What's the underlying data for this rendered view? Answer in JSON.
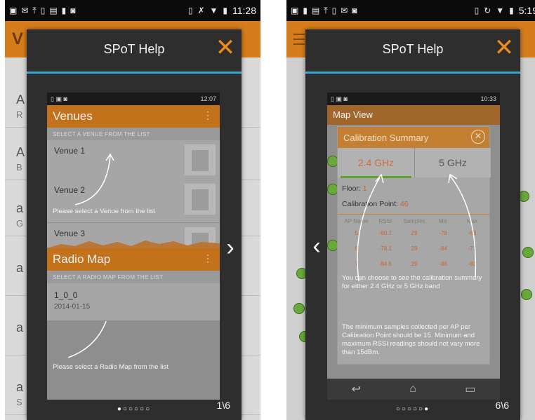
{
  "panel_left": {
    "status": {
      "time": "11:28"
    },
    "background_rows": [
      {
        "title": "A",
        "sub": "R"
      },
      {
        "title": "A",
        "sub": "B"
      },
      {
        "title": "a",
        "sub": "G"
      },
      {
        "title": "a",
        "sub": ""
      },
      {
        "title": "a",
        "sub": ""
      },
      {
        "title": "a",
        "sub": "S"
      }
    ],
    "app_initial": "V",
    "dialog": {
      "title": "SPoT Help",
      "close": "✕",
      "next_arrow": "›",
      "pager": "●○○○○○",
      "page_count": "1\\6"
    },
    "screenshot": {
      "status_time": "12:07",
      "venues_header": "Venues",
      "venues_sub": "SELECT A VENUE FROM THE LIST",
      "venues": [
        "Venue 1",
        "Venue 2",
        "Venue 3"
      ],
      "venue_hint": "Please select a Venue from the list",
      "radiomap_header": "Radio Map",
      "radiomap_sub": "SELECT A RADIO MAP FROM THE LIST",
      "radiomap_item": "1_0_0",
      "radiomap_date": "2014-01-15",
      "radiomap_hint": "Please select a Radio Map from the list"
    }
  },
  "panel_right": {
    "status": {
      "time": "5:19"
    },
    "dialog": {
      "title": "SPoT Help",
      "close": "✕",
      "prev_arrow": "‹",
      "pager": "○○○○○●",
      "page_count": "6\\6"
    },
    "screenshot": {
      "status_time": "10:33",
      "map_title": "Map View",
      "cal_title": "Calibration Summary",
      "cal_close": "✕",
      "band_24": "2.4 GHz",
      "band_5": "5 GHz",
      "floor_label": "Floor:",
      "floor_value": "1",
      "cal_point_label": "Calibration Point:",
      "cal_point_value": "46",
      "grid_header": [
        "AP Name",
        "RSSI",
        "Samples",
        "Min",
        "Max"
      ],
      "grid_rows": [
        [
          "5",
          "-60.7",
          "29",
          "-79",
          "-68"
        ],
        [
          "6",
          "-78.1",
          "29",
          "-84",
          "-71"
        ],
        [
          "7",
          "-84.6",
          "29",
          "-86",
          "-83"
        ]
      ],
      "hint1": "You can choose to see the calibration summary for either 2.4 GHz or 5 GHz band",
      "hint2": "The minimum samples collected per AP per Calibration Point should be 15. Minimum and maximum RSSI readings should not vary more than 15dBm.",
      "nav_back": "↩",
      "nav_home": "⌂",
      "nav_recent": "▭"
    }
  },
  "colors": {
    "accent": "#f08a1a",
    "header": "#c4711c",
    "divider": "#34a7d2",
    "green": "#5aa42e"
  }
}
